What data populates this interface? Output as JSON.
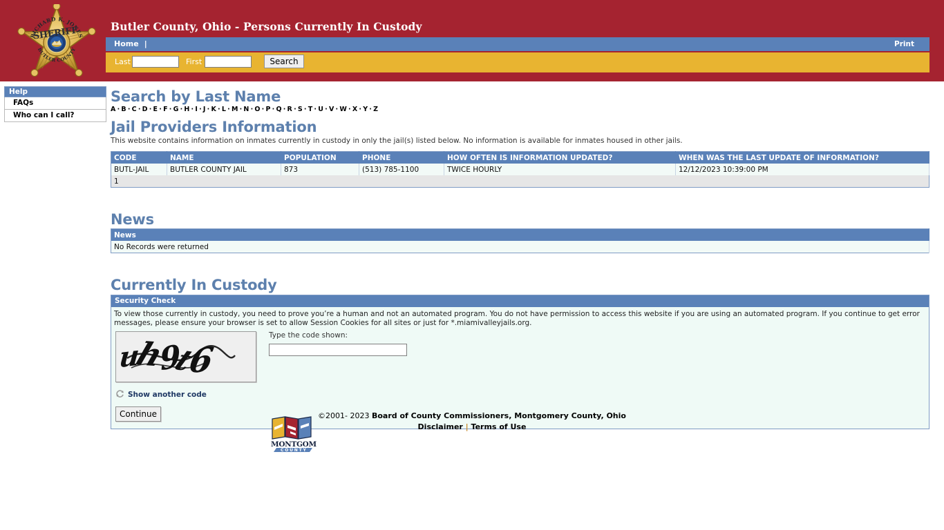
{
  "header": {
    "title": "Butler County, Ohio - Persons Currently In Custody",
    "badge": {
      "top_text": "RICHARD K. JONES",
      "center_text": "SHERIFF",
      "bottom_text": "BUTLER COUNTY"
    },
    "nav": {
      "home_label": "Home",
      "separator": "|",
      "print_label": "Print"
    },
    "search": {
      "last_label": "Last",
      "last_value": "",
      "last_placeholder": "",
      "first_label": "First",
      "first_value": "",
      "first_placeholder": "",
      "search_button": "Search"
    }
  },
  "sidebar": {
    "header": "Help",
    "items": [
      {
        "label": "FAQs"
      },
      {
        "label": "Who can I call?"
      }
    ]
  },
  "main": {
    "search_by_last_name": {
      "title": "Search by Last Name",
      "letters": [
        "A",
        "B",
        "C",
        "D",
        "E",
        "F",
        "G",
        "H",
        "I",
        "J",
        "K",
        "L",
        "M",
        "N",
        "O",
        "P",
        "Q",
        "R",
        "S",
        "T",
        "U",
        "V",
        "W",
        "X",
        "Y",
        "Z"
      ],
      "separator": "·"
    },
    "jail_providers": {
      "title": "Jail Providers Information",
      "description": "This website contains information on inmates currently in custody in only the jail(s) listed below. No information is available for inmates housed in other jails.",
      "columns": [
        "CODE",
        "NAME",
        "POPULATION",
        "PHONE",
        "HOW OFTEN IS INFORMATION UPDATED?",
        "WHEN WAS THE LAST UPDATE OF INFORMATION?"
      ],
      "rows": [
        {
          "code": "BUTL-JAIL",
          "name": "BUTLER COUNTY JAIL",
          "population": "873",
          "phone": "(513) 785-1100",
          "frequency": "TWICE HOURLY",
          "last_update": "12/12/2023 10:39:00 PM"
        }
      ],
      "pager": "1"
    },
    "news": {
      "title": "News",
      "column": "News",
      "empty_message": "No Records were returned"
    },
    "custody": {
      "title": "Currently In Custody",
      "security_check": {
        "panel_title": "Security Check",
        "paragraph": "To view those currently in custody, you need to prove you’re a human and not an automated program. You do not have permission to access this website if you are using an automated program. If you continue to get error messages, please ensure your browser is set to allow Session Cookies for all sites or just for *.miamivalleyjails.org.",
        "captcha_code": "uh9t6",
        "captcha_label": "Type the code shown:",
        "captcha_value": "",
        "refresh_label": "Show another code",
        "continue_label": "Continue"
      }
    }
  },
  "footer": {
    "logo_text_main": "MONTGOMERY",
    "logo_text_sub": "COUNTY",
    "copyright_prefix": "©2001- 2023 ",
    "copyright_org": "Board of County Commissioners, Montgomery County, Ohio",
    "disclaimer_label": "Disclaimer",
    "separator": "|",
    "terms_label": "Terms of Use"
  },
  "colors": {
    "header_red": "#a52330",
    "nav_blue": "#5a81b8",
    "search_yellow": "#e8b431",
    "heading_blue": "#5d80ad",
    "table_row_bg": "#f2faf7",
    "panel_bg": "#effaf6"
  }
}
